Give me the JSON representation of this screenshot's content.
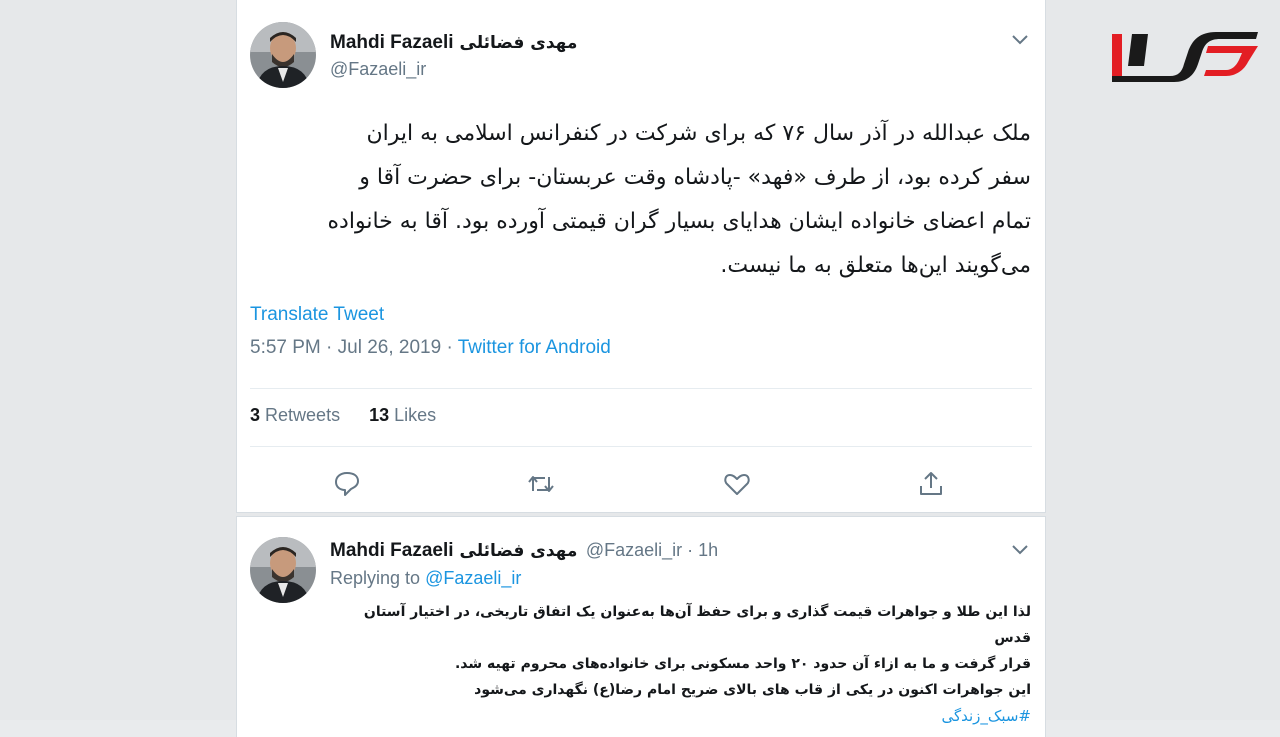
{
  "logo": {
    "text": "رکنا",
    "color": "#e31e24",
    "accent": "#1a1a1a"
  },
  "tweet1": {
    "author_en": "Mahdi Fazaeli",
    "author_fa": "مهدی فضائلی",
    "handle": "@Fazaeli_ir",
    "body_lines": [
      "ملک عبدالله در آذر سال ۷۶ که برای شرکت در کنفرانس اسلامی به ایران",
      "سفر کرده بود، از طرف «فهد» -پادشاه وقت عربستان- برای حضرت آقا و",
      "تمام اعضای خانواده ایشان هدایای بسیار گران قیمتی آورده بود. آقا به خانواده",
      "می‌گویند این‌ها متعلق به ما نیست."
    ],
    "translate": "Translate Tweet",
    "time": "5:57 PM · Jul 26, 2019 · ",
    "source": "Twitter for Android",
    "retweets_count": "3",
    "retweets_label": "Retweets",
    "likes_count": "13",
    "likes_label": "Likes"
  },
  "tweet2": {
    "author_en": "Mahdi Fazaeli",
    "author_fa": "مهدی فضائلی",
    "handle_time": "@Fazaeli_ir · 1h",
    "replying_prefix": "Replying to ",
    "replying_handle": "@Fazaeli_ir",
    "body_lines": [
      "لذا این طلا و جواهرات قیمت گذاری و برای حفظ آن‌ها به‌عنوان یک اتفاق تاریخی، در اختیار آستان قدس",
      "قرار گرفت و ما به ازاء آن حدود ۲۰ واحد مسکونی برای خانواده‌های محروم تهیه شد.",
      "این جواهرات اکنون در یکی از قاب های بالای ضریح امام رضا(ع) نگهداری می‌شود"
    ],
    "hashtag": "#سبک_زندگی"
  },
  "icons": [
    "reply-icon",
    "retweet-icon",
    "like-icon",
    "share-icon",
    "chevron-down-icon"
  ]
}
